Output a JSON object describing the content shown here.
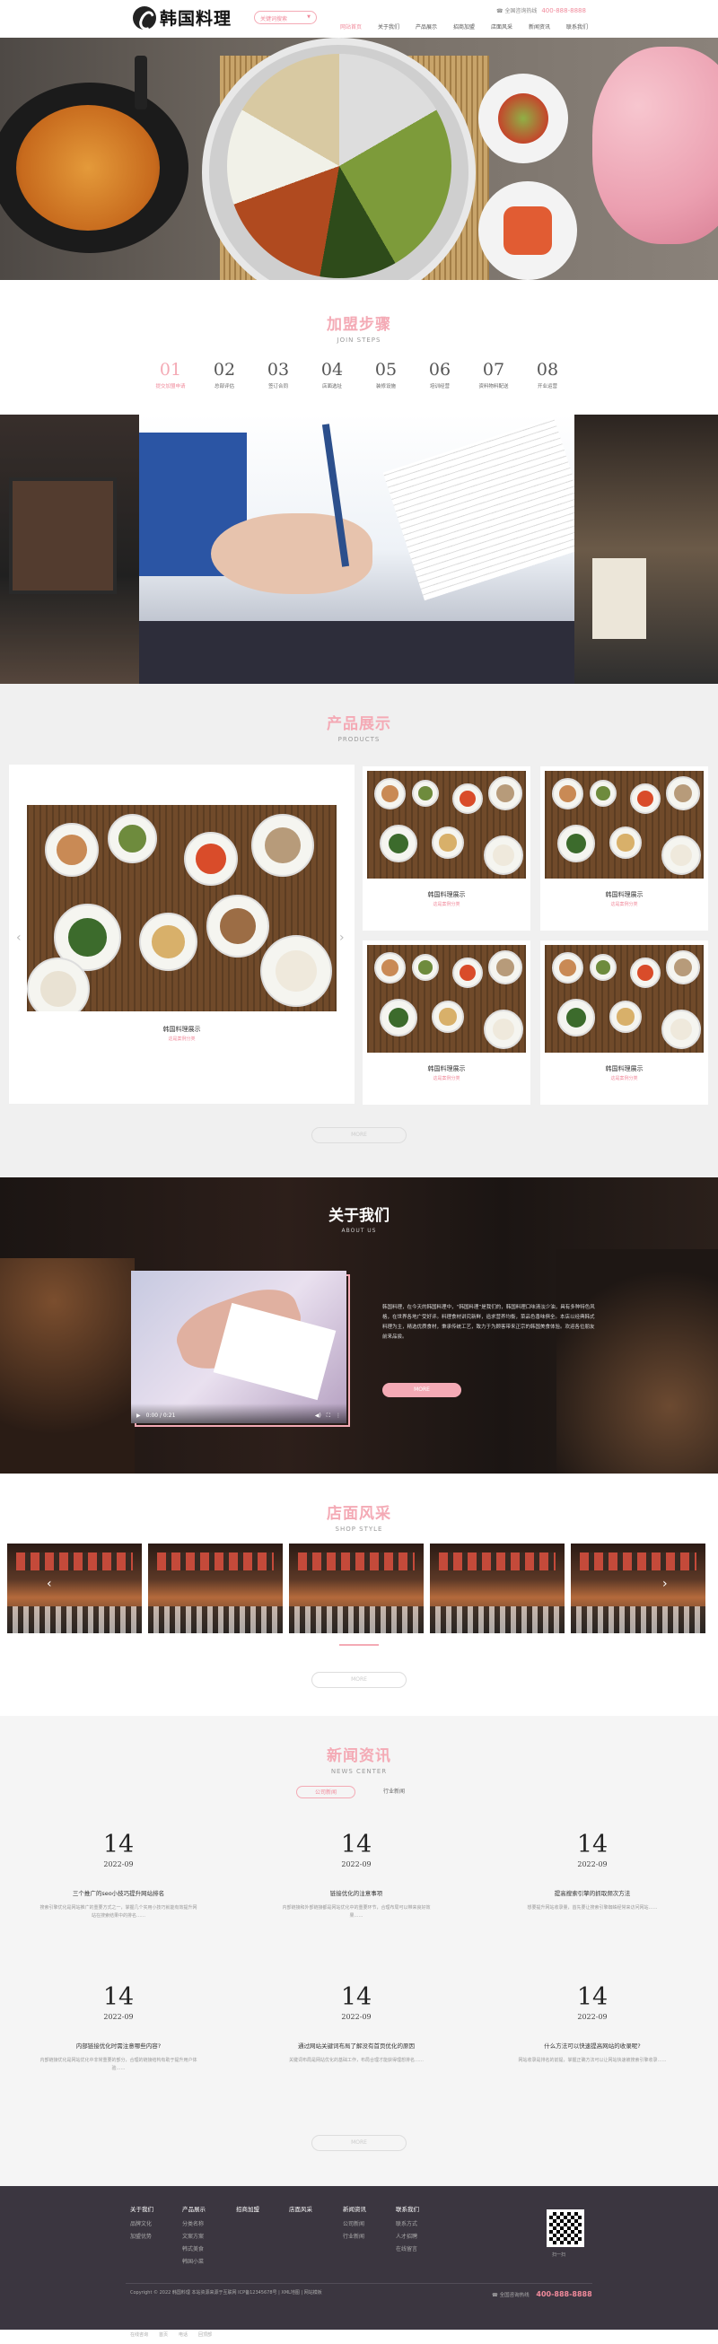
{
  "header": {
    "logo_text": "韩国料理",
    "search_placeholder": "关键词搜索",
    "hotline_label": "全国咨询热线",
    "hotline_number": "400-888-8888",
    "nav": [
      "网站首页",
      "关于我们",
      "产品展示",
      "招商加盟",
      "店面风采",
      "新闻资讯",
      "联系我们"
    ]
  },
  "join": {
    "title": "加盟步骤",
    "subtitle": "JOIN STEPS",
    "steps": [
      {
        "num": "01",
        "label": "提交加盟申请"
      },
      {
        "num": "02",
        "label": "总部评估"
      },
      {
        "num": "03",
        "label": "签订合同"
      },
      {
        "num": "04",
        "label": "店面选址"
      },
      {
        "num": "05",
        "label": "装修设施"
      },
      {
        "num": "06",
        "label": "培训经营"
      },
      {
        "num": "07",
        "label": "资料物料配送"
      },
      {
        "num": "08",
        "label": "开业运营"
      }
    ]
  },
  "products": {
    "title": "产品展示",
    "subtitle": "PRODUCTS",
    "items": [
      {
        "name": "韩国料理展示",
        "category": "这是案例分类"
      },
      {
        "name": "韩国料理展示",
        "category": "这是案例分类"
      },
      {
        "name": "韩国料理展示",
        "category": "这是案例分类"
      },
      {
        "name": "韩国料理展示",
        "category": "这是案例分类"
      },
      {
        "name": "韩国料理展示",
        "category": "这是案例分类"
      }
    ],
    "more": "MORE"
  },
  "about": {
    "title": "关于我们",
    "subtitle": "ABOUT US",
    "video_time": "0:00 / 0:21",
    "text": "韩国料理，在今天的韩国料理中，“韩国料理”是我们的，韩国料理口味清淡少油，具有多种特色风格，在世界各地广受好评。料理食材讲究新鲜，追求营养均衡，菜品色香味俱全。本店以经典韩式料理为主，精选优质食材，秉承传统工艺，致力于为顾客带来正宗的韩国美食体验。欢迎各位朋友前来品尝。",
    "button": "MORE"
  },
  "shop": {
    "title": "店面风采",
    "subtitle": "SHOP STYLE",
    "more": "MORE"
  },
  "news": {
    "title": "新闻资讯",
    "subtitle": "NEWS CENTER",
    "tabs": [
      "公司新闻",
      "行业新闻"
    ],
    "items": [
      {
        "day": "14",
        "ym": "2022-09",
        "title": "三个推广的seo小技巧提升网站排名",
        "desc": "搜索引擎优化是网站推广的重要方式之一，掌握几个实用小技巧就能有效提升网站在搜索结果中的排名……"
      },
      {
        "day": "14",
        "ym": "2022-09",
        "title": "链接优化的注意事项",
        "desc": "内部链接和外部链接都是网站优化中的重要环节，合理布局可以带来良好效果……"
      },
      {
        "day": "14",
        "ym": "2022-09",
        "title": "提高搜索引擎的抓取频次方法",
        "desc": "想要提升网站收录量，首先要让搜索引擎蜘蛛经常来访问网站……"
      },
      {
        "day": "14",
        "ym": "2022-09",
        "title": "内部链接优化时需注意哪些内容?",
        "desc": "内部链接优化是网站优化中非常重要的部分，合理的链接结构有助于提升用户体验……"
      },
      {
        "day": "14",
        "ym": "2022-09",
        "title": "通过网站关键词布局了解没有首页优化的原因",
        "desc": "关键词布局是网站优化的基础工作，布局合理才能获得理想排名……"
      },
      {
        "day": "14",
        "ym": "2022-09",
        "title": "什么方法可以快速提高网站的收录呢?",
        "desc": "网站收录是排名的前提，掌握正确方法可以让网站快速被搜索引擎收录……"
      }
    ],
    "more": "MORE"
  },
  "footer": {
    "columns": [
      {
        "head": "关于我们",
        "links": [
          "品牌文化",
          "加盟优势"
        ]
      },
      {
        "head": "产品展示",
        "links": [
          "分类名称",
          "文案方案",
          "韩式美食",
          "韩国小菜"
        ]
      },
      {
        "head": "招商加盟",
        "links": []
      },
      {
        "head": "店面风采",
        "links": []
      },
      {
        "head": "新闻资讯",
        "links": [
          "公司新闻",
          "行业新闻"
        ]
      },
      {
        "head": "联系我们",
        "links": [
          "联系方式",
          "人才招聘",
          "在线留言"
        ]
      }
    ],
    "qr_label": "扫一扫",
    "copyright": "Copyright © 2022 韩国料理 本站资源来源于互联网 ICP备12345678号 | XML地图 | 网站模板",
    "hotline_label": "全国咨询热线",
    "hotline_number": "400-888-8888",
    "bottom_links": [
      "在线咨询",
      "首页",
      "电话",
      "回顶部"
    ]
  }
}
